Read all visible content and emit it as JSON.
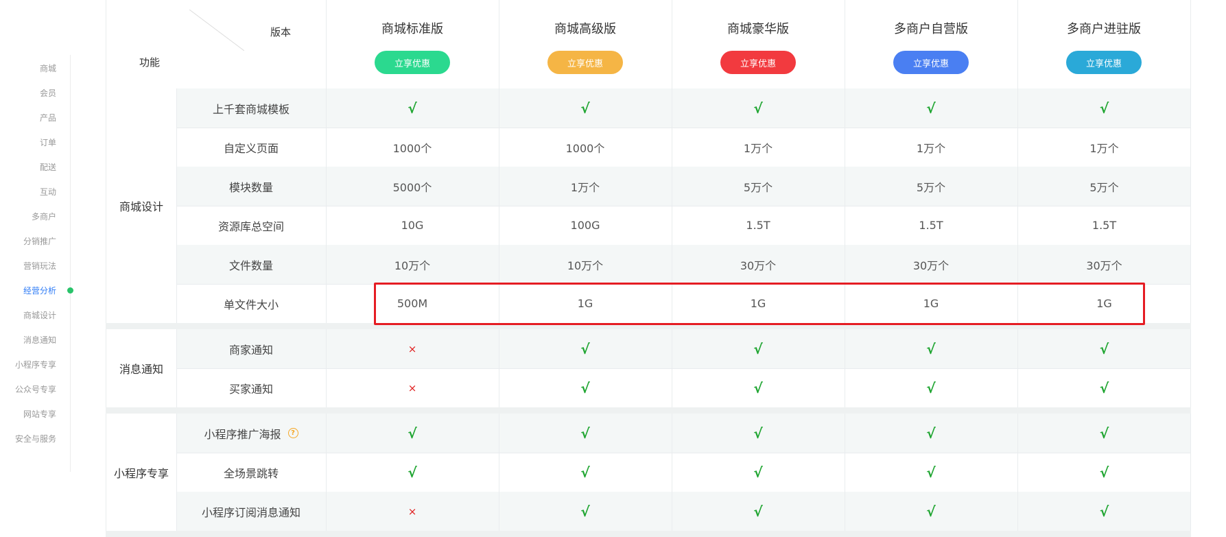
{
  "sidebar": {
    "items": [
      {
        "label": "商城"
      },
      {
        "label": "会员"
      },
      {
        "label": "产品"
      },
      {
        "label": "订单"
      },
      {
        "label": "配送"
      },
      {
        "label": "互动"
      },
      {
        "label": "多商户"
      },
      {
        "label": "分销推广"
      },
      {
        "label": "营销玩法"
      },
      {
        "label": "经营分析",
        "active": true
      },
      {
        "label": "商城设计"
      },
      {
        "label": "消息通知"
      },
      {
        "label": "小程序专享"
      },
      {
        "label": "公众号专享"
      },
      {
        "label": "网站专享"
      },
      {
        "label": "安全与服务"
      }
    ]
  },
  "header": {
    "version_label": "版本",
    "feature_label": "功能",
    "versions": [
      {
        "name": "商城标准版",
        "cta": "立享优惠",
        "color": "#2bd98f"
      },
      {
        "name": "商城高级版",
        "cta": "立享优惠",
        "color": "#f5b545"
      },
      {
        "name": "商城豪华版",
        "cta": "立享优惠",
        "color": "#f23a3f"
      },
      {
        "name": "多商户自营版",
        "cta": "立享优惠",
        "color": "#4a7ff2"
      },
      {
        "name": "多商户进驻版",
        "cta": "立享优惠",
        "color": "#2aa9d8"
      }
    ]
  },
  "groups": [
    {
      "name": "商城设计",
      "rows": [
        {
          "feature": "上千套商城模板",
          "values": [
            "√",
            "√",
            "√",
            "√",
            "√"
          ]
        },
        {
          "feature": "自定义页面",
          "values": [
            "1000个",
            "1000个",
            "1万个",
            "1万个",
            "1万个"
          ]
        },
        {
          "feature": "模块数量",
          "values": [
            "5000个",
            "1万个",
            "5万个",
            "5万个",
            "5万个"
          ]
        },
        {
          "feature": "资源库总空间",
          "values": [
            "10G",
            "100G",
            "1.5T",
            "1.5T",
            "1.5T"
          ]
        },
        {
          "feature": "文件数量",
          "values": [
            "10万个",
            "10万个",
            "30万个",
            "30万个",
            "30万个"
          ]
        },
        {
          "feature": "单文件大小",
          "values": [
            "500M",
            "1G",
            "1G",
            "1G",
            "1G"
          ]
        }
      ]
    },
    {
      "name": "消息通知",
      "rows": [
        {
          "feature": "商家通知",
          "values": [
            "×",
            "√",
            "√",
            "√",
            "√"
          ]
        },
        {
          "feature": "买家通知",
          "values": [
            "×",
            "√",
            "√",
            "√",
            "√"
          ]
        }
      ]
    },
    {
      "name": "小程序专享",
      "rows": [
        {
          "feature": "小程序推广海报",
          "help": "?",
          "values": [
            "√",
            "√",
            "√",
            "√",
            "√"
          ]
        },
        {
          "feature": "全场景跳转",
          "values": [
            "√",
            "√",
            "√",
            "√",
            "√"
          ]
        },
        {
          "feature": "小程序订阅消息通知",
          "values": [
            "×",
            "√",
            "√",
            "√",
            "√"
          ]
        }
      ]
    }
  ],
  "colors": {
    "check": "#1fa531",
    "cross": "#e02020",
    "highlight": "#e51c23",
    "active_nav": "#2f7cf6",
    "nav_dot": "#29c36a"
  }
}
